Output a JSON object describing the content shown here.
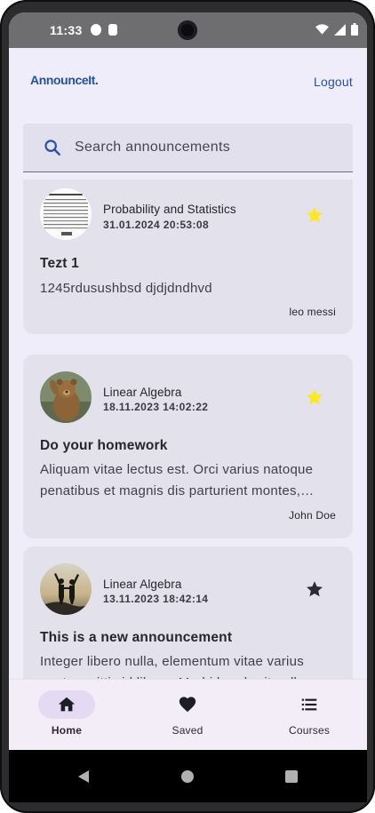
{
  "status_bar": {
    "time": "11:33"
  },
  "header": {
    "logo": "AnnounceIt.",
    "logout_label": "Logout"
  },
  "search": {
    "placeholder": "Search announcements",
    "value": ""
  },
  "announcements": [
    {
      "course": "Probability and Statistics",
      "date": "31.01.2024 20:53:08",
      "title": "Tezt 1",
      "body": "1245rdusushbsd djdjdndhvd",
      "author": "leo messi",
      "saved": true,
      "avatar_icon": "document-thumbnail"
    },
    {
      "course": "Linear Algebra",
      "date": "18.11.2023 14:02:22",
      "title": "Do your homework",
      "body": "Aliquam vitae lectus est. Orci varius natoque penatibus et magnis dis parturient montes, nascetur ridiculus mus.",
      "author": "John Doe",
      "saved": true,
      "avatar_icon": "bear-photo"
    },
    {
      "course": "Linear Algebra",
      "date": "13.11.2023 18:42:14",
      "title": "This is a new announcement",
      "body": "Integer libero nulla, elementum vitae varius eget, sagittis id libero. Morbi hendrerit nulla vel nibh.",
      "author": "",
      "saved": false,
      "avatar_icon": "people-silhouette-photo"
    }
  ],
  "bottom_nav": {
    "items": [
      {
        "label": "Home",
        "icon": "home-icon",
        "active": true
      },
      {
        "label": "Saved",
        "icon": "heart-icon",
        "active": false
      },
      {
        "label": "Courses",
        "icon": "list-icon",
        "active": false
      }
    ]
  },
  "colors": {
    "accent": "#2451a8",
    "star_saved": "#ffe81a",
    "star_unsaved": "#2b2b35",
    "card_bg": "#e2e1ec",
    "screen_bg": "#efedf9"
  }
}
